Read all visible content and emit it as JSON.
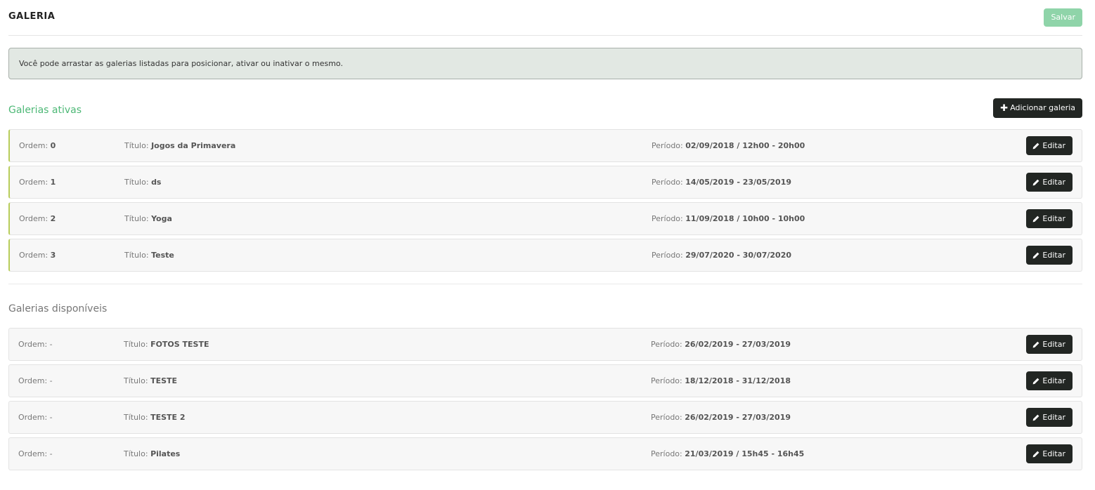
{
  "header": {
    "title": "GALERIA",
    "save_label": "Salvar"
  },
  "alert": {
    "text": "Você pode arrastar as galerias listadas para posicionar, ativar ou inativar o mesmo."
  },
  "active": {
    "title": "Galerias ativas",
    "add_label": "Adicionar galeria",
    "add_icon": "plus-icon",
    "rows": [
      {
        "order_label": "Ordem:",
        "order": "0",
        "title_label": "Título:",
        "title": "Jogos da Primavera",
        "period_label": "Período:",
        "period": "02/09/2018 / 12h00 - 20h00",
        "edit_label": "Editar"
      },
      {
        "order_label": "Ordem:",
        "order": "1",
        "title_label": "Título:",
        "title": "ds",
        "period_label": "Período:",
        "period": "14/05/2019 - 23/05/2019",
        "edit_label": "Editar"
      },
      {
        "order_label": "Ordem:",
        "order": "2",
        "title_label": "Título:",
        "title": "Yoga",
        "period_label": "Período:",
        "period": "11/09/2018 / 10h00 - 10h00",
        "edit_label": "Editar"
      },
      {
        "order_label": "Ordem:",
        "order": "3",
        "title_label": "Título:",
        "title": "Teste",
        "period_label": "Período:",
        "period": "29/07/2020 - 30/07/2020",
        "edit_label": "Editar"
      }
    ]
  },
  "available": {
    "title": "Galerias disponíveis",
    "rows": [
      {
        "order_label": "Ordem:",
        "order": "-",
        "title_label": "Título:",
        "title": "FOTOS TESTE",
        "period_label": "Período:",
        "period": "26/02/2019 - 27/03/2019",
        "edit_label": "Editar"
      },
      {
        "order_label": "Ordem:",
        "order": "-",
        "title_label": "Título:",
        "title": "TESTE",
        "period_label": "Período:",
        "period": "18/12/2018 - 31/12/2018",
        "edit_label": "Editar"
      },
      {
        "order_label": "Ordem:",
        "order": "-",
        "title_label": "Título:",
        "title": "TESTE 2",
        "period_label": "Período:",
        "period": "26/02/2019 - 27/03/2019",
        "edit_label": "Editar"
      },
      {
        "order_label": "Ordem:",
        "order": "-",
        "title_label": "Título:",
        "title": "Pilates",
        "period_label": "Período:",
        "period": "21/03/2019 / 15h45 - 16h45",
        "edit_label": "Editar"
      }
    ]
  },
  "colors": {
    "accent_green": "#4db876",
    "save_button": "#8fd4a9",
    "dark_button": "#222623",
    "alert_bg": "#e2e8e3",
    "active_border": "#b8cd5a"
  },
  "icons": {
    "edit": "pencil-icon",
    "add": "plus-icon"
  }
}
